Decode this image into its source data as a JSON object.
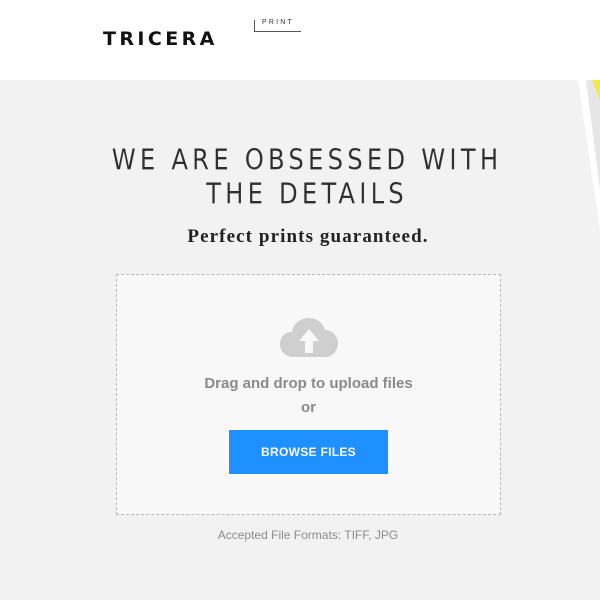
{
  "header": {
    "logo_main": "TRICERA",
    "logo_sub": "PRINT"
  },
  "hero": {
    "headline_line1": "WE ARE OBSESSED WITH",
    "headline_line2": "THE DETAILS",
    "tagline": "Perfect prints guaranteed."
  },
  "upload": {
    "icon": "cloud-upload-icon",
    "drag_text": "Drag and drop to upload files",
    "or_text": "or",
    "browse_label": "BROWSE FILES",
    "accepted_formats": "Accepted File Formats: TIFF, JPG"
  },
  "colors": {
    "accent": "#1e90ff",
    "background": "#f2f2f2",
    "header_bg": "#ffffff",
    "icon_gray": "#cfcfcf",
    "deco_yellow": "#f4e84a"
  }
}
